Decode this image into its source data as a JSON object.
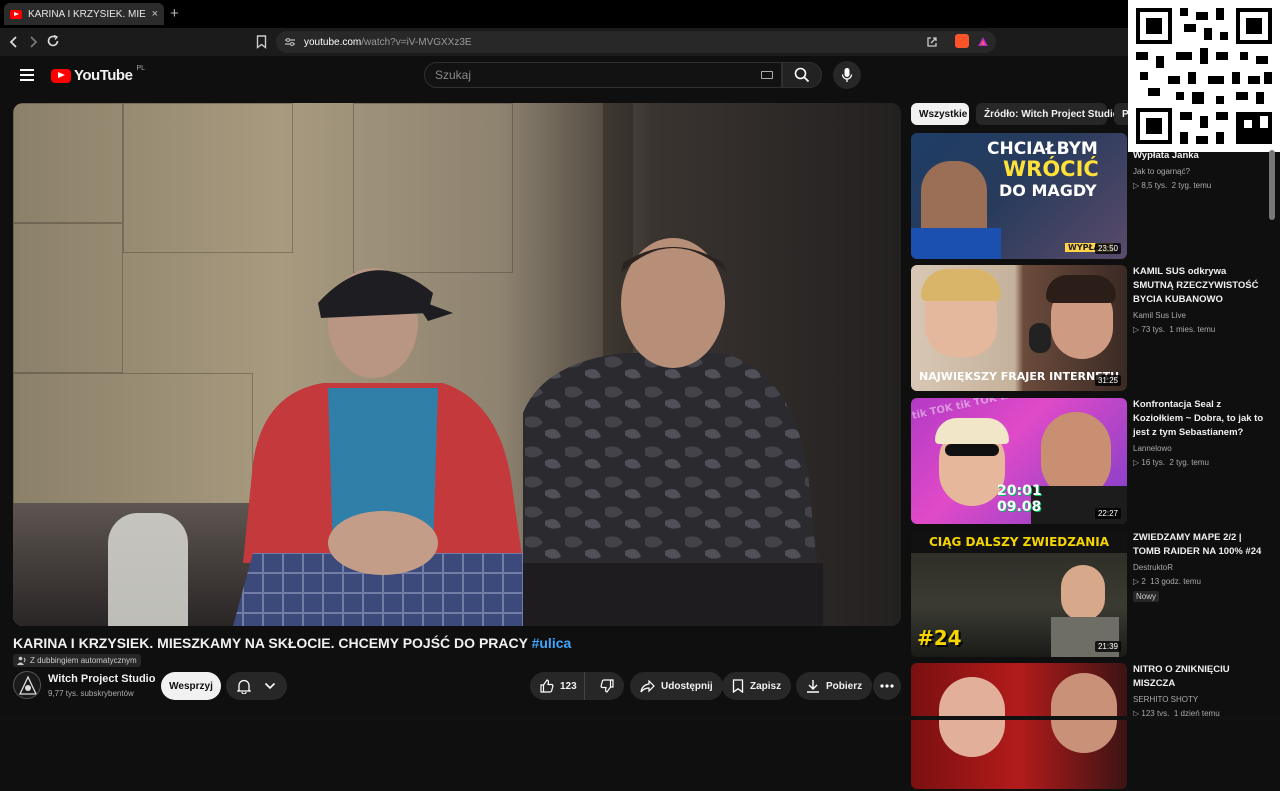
{
  "browser": {
    "tab_title": "KARINA I KRZYSIEK. MIESZKAMY NA",
    "tab_close": "×",
    "new_tab": "+",
    "url_host": "youtube.com",
    "url_path": "/watch?v=iV-MVGXXz3E"
  },
  "youtube": {
    "logo_text": "YouTube",
    "country_code": "PL",
    "search_placeholder": "Szukaj"
  },
  "video": {
    "title": "KARINA I KRZYSIEK. MIESZKAMY NA SKŁOCIE. CHCEMY POJŚĆ DO PRACY",
    "hashtag": "#ulica",
    "dubbing_label": "Z dubbingiem automatycznym",
    "channel_name": "Witch Project Studio",
    "subscribers": "9,77 tys. subskrybentów",
    "support_label": "Wesprzyj",
    "likes": "123",
    "share_label": "Udostępnij",
    "save_label": "Zapisz",
    "download_label": "Pobierz"
  },
  "chips": [
    "Wszystkie",
    "Źródło: Witch Project Studio",
    "P"
  ],
  "recommendations": [
    {
      "title": "Wypłata Janka",
      "channel": "Jak to ogarnąć?",
      "views": "8,5 tys.",
      "age": "2 tyg. temu",
      "duration": "23:50",
      "overlay_line1": "CHCIAŁBYM",
      "overlay_line2": "WRÓCIĆ",
      "overlay_line3": "DO MAGDY",
      "overlay_tag": "WYPŁATA"
    },
    {
      "title": "KAMIL SUS odkrywa SMUTNĄ RZECZYWISTOŚĆ BYCIA KUBANOWO",
      "channel": "Kamil Sus Live",
      "views": "73 tys.",
      "age": "1 mies. temu",
      "duration": "31:25",
      "overlay_line1": "NAJWIĘKSZY FRAJER INTERNETU"
    },
    {
      "title": "Konfrontacja Seal z Koziołkiem ~ Dobra, to jak to jest z tym Sebastianem?",
      "channel": "Lannelowo",
      "views": "16 tys.",
      "age": "2 tyg. temu",
      "duration": "22:27",
      "overlay_time": "20:01",
      "overlay_date": "09.08",
      "overlay_bg": "tik TOK tik TOK tik"
    },
    {
      "title": "ZWIEDZAMY MAPE 2/2 | TOMB RAIDER NA 100% #24",
      "channel": "DestruktoR",
      "views": "2",
      "age": "13 godz. temu",
      "badge": "Nowy",
      "duration": "21:39",
      "overlay_line1": "CIĄG DALSZY ZWIEDZANIA",
      "overlay_num": "#24"
    },
    {
      "title": "NITRO O ZNIKNIĘCIU MISZCZA",
      "channel": "SERHITO SHOTY",
      "views": "123 tys.",
      "age": "1 dzień temu"
    }
  ],
  "colors": {
    "background": "#0f0f0f",
    "accent_red": "#ff0000",
    "hashtag_blue": "#3ea6ff",
    "chip_active": "#f1f1f1"
  },
  "icons": [
    "back-icon",
    "forward-icon",
    "reload-icon",
    "bookmark-icon",
    "site-info-icon",
    "open-external-icon",
    "brave-icon",
    "menu-icon",
    "search-icon",
    "keyboard-icon",
    "mic-icon",
    "bell-icon",
    "chevron-down-icon",
    "thumbs-up-icon",
    "thumbs-down-icon",
    "share-icon",
    "save-icon",
    "download-icon",
    "more-icon",
    "qr-code"
  ]
}
